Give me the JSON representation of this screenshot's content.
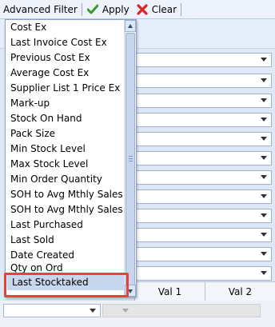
{
  "toolbar": {
    "filter_label": "Advanced Filter",
    "apply_label": "Apply",
    "clear_label": "Clear"
  },
  "dropdown": {
    "items": [
      "Cost Ex",
      "Last Invoice Cost Ex",
      "Previous Cost Ex",
      "Average Cost Ex",
      "Supplier List 1 Price Ex",
      "Mark-up",
      "Stock On Hand",
      "Pack Size",
      "Min Stock Level",
      "Max Stock Level",
      "Min Order Quantity",
      "SOH to Avg Mthly Sales",
      "SOH to Avg Mthly Sales %",
      "Last Purchased",
      "Last Sold",
      "Date Created",
      "Qty on Ord"
    ],
    "selected": "Last Stocktaked"
  },
  "grid": {
    "col1": "Val 1",
    "col2": "Val 2"
  },
  "colors": {
    "highlight": "#e8413a",
    "apply_icon": "#3a9a2a",
    "clear_icon": "#d8261e"
  }
}
